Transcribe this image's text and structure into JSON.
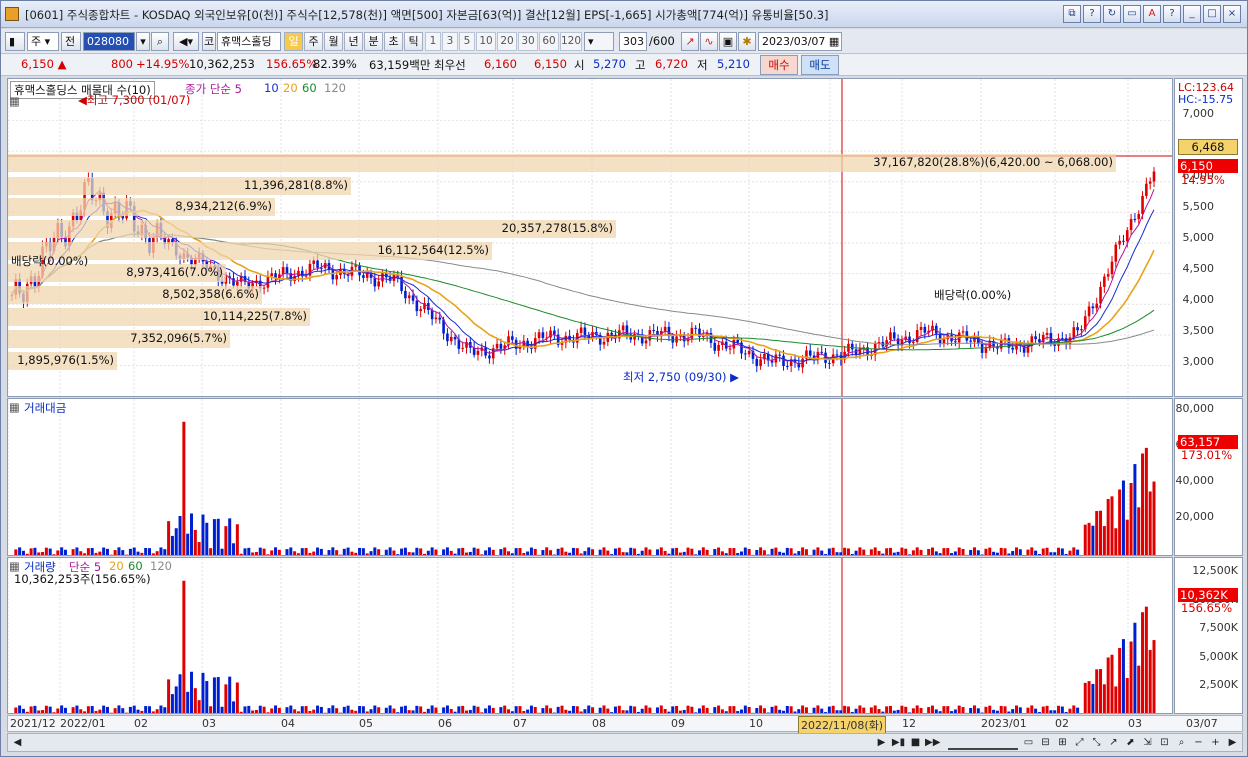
{
  "window": {
    "title": "[0601] 주식종합차트 - KOSDAQ 외국인보유[0(천)] 주식수[12,578(천)] 액면[500] 자본금[63(억)] 결산[12월] EPS[-1,665] 시가총액[774(억)] 유통비율[50.3]",
    "buttons": [
      "⧉",
      "?",
      "↻",
      "▭",
      "A",
      "?",
      "_",
      "□",
      "×"
    ]
  },
  "toolbar": {
    "type_select": "주",
    "prev_label": "전",
    "code_value": "028080",
    "market_label": "코",
    "stock_name": "휴맥스홀딩",
    "periods": [
      "일",
      "주",
      "월",
      "년",
      "분",
      "초",
      "틱"
    ],
    "active_period": "일",
    "intervals": [
      "1",
      "3",
      "5",
      "10",
      "20",
      "30",
      "60",
      "120"
    ],
    "count_value": "303",
    "count_total": "/600",
    "date_value": "2023/03/07"
  },
  "quote": {
    "price": "6,150",
    "arrow": "▲",
    "change": "800",
    "change_pct": "+14.95%",
    "volume": "10,362,253",
    "volume_ratio": "156.65%",
    "turnover": "82.39%",
    "amount": "63,159백만",
    "best_label": "최우선",
    "ask": "6,160",
    "bid": "6,150",
    "open_label": "시",
    "open": "5,270",
    "high_label": "고",
    "high": "6,720",
    "low_label": "저",
    "low": "5,210",
    "buy_button": "매수",
    "sell_button": "매도"
  },
  "price_panel": {
    "legend_title": "휴맥스홀딩스 매물대 수(10)",
    "ma_label": "종가 단순 5",
    "ma_periods": [
      "10",
      "20",
      "60",
      "120"
    ],
    "ma_colors": [
      "#1a2bd6",
      "#e8a21a",
      "#1a8a2a",
      "#8a8a8a"
    ],
    "high_note": "최고 7,300 (01/07)",
    "low_note": "최저 2,750 (09/30)",
    "dividend_left": "배당락(0.00%)",
    "dividend_right": "배당락(0.00%)",
    "lc": "LC:123.64",
    "hc": "HC:-15.75",
    "axis_ticks": [
      "7,000",
      "6,500",
      "6,000",
      "5,500",
      "5,000",
      "4,500",
      "4,000",
      "3,500",
      "3,000"
    ],
    "current_marker": "6,468",
    "price_marker": "6,150",
    "price_marker_pct": "14.95%",
    "volume_profile": [
      "37,167,820(28.8%)(6,420.00 ~ 6,068.00)",
      "11,396,281(8.8%)",
      "8,934,212(6.9%)",
      "20,357,278(15.8%)",
      "16,112,564(12.5%)",
      "8,973,416(7.0%)",
      "8,502,358(6.6%)",
      "10,114,225(7.8%)",
      "7,352,096(5.7%)",
      "1,895,976(1.5%)"
    ],
    "volume_profile_pct": [
      28.8,
      8.8,
      6.9,
      15.8,
      12.5,
      7.0,
      6.6,
      7.8,
      5.7,
      1.5
    ]
  },
  "amount_panel": {
    "title": "거래대금",
    "axis_ticks": [
      "80,000",
      "60,000",
      "40,000",
      "20,000"
    ],
    "marker": "63,157",
    "marker_pct": "173.01%"
  },
  "volume_panel": {
    "title": "거래량",
    "ma_label": "단순 5",
    "ma_periods": [
      "20",
      "60",
      "120"
    ],
    "current": "10,362,253주(156.65%)",
    "axis_ticks": [
      "12,500K",
      "10,000K",
      "7,500K",
      "5,000K",
      "2,500K"
    ],
    "marker": "10,362K",
    "marker_pct": "156.65%"
  },
  "date_axis": {
    "labels": [
      "2021/12",
      "2022/01",
      "02",
      "03",
      "04",
      "05",
      "06",
      "07",
      "08",
      "09",
      "10",
      "2022/11/08(화)",
      "12",
      "2023/01",
      "02",
      "03",
      "03/07"
    ]
  },
  "chart_data": {
    "type": "line",
    "title": "휴맥스홀딩스",
    "x": [
      "2021/12",
      "2022/01",
      "02",
      "03",
      "04",
      "05",
      "06",
      "07",
      "08",
      "09",
      "10",
      "11",
      "12",
      "2023/01",
      "02",
      "03"
    ],
    "series": [
      {
        "name": "종가",
        "values": [
          4000,
          5800,
          5000,
          4300,
          4600,
          4400,
          3200,
          3450,
          3500,
          3500,
          3050,
          3200,
          3550,
          3300,
          3500,
          6150
        ]
      }
    ],
    "ylim": [
      2700,
      7300
    ],
    "grid": true
  }
}
